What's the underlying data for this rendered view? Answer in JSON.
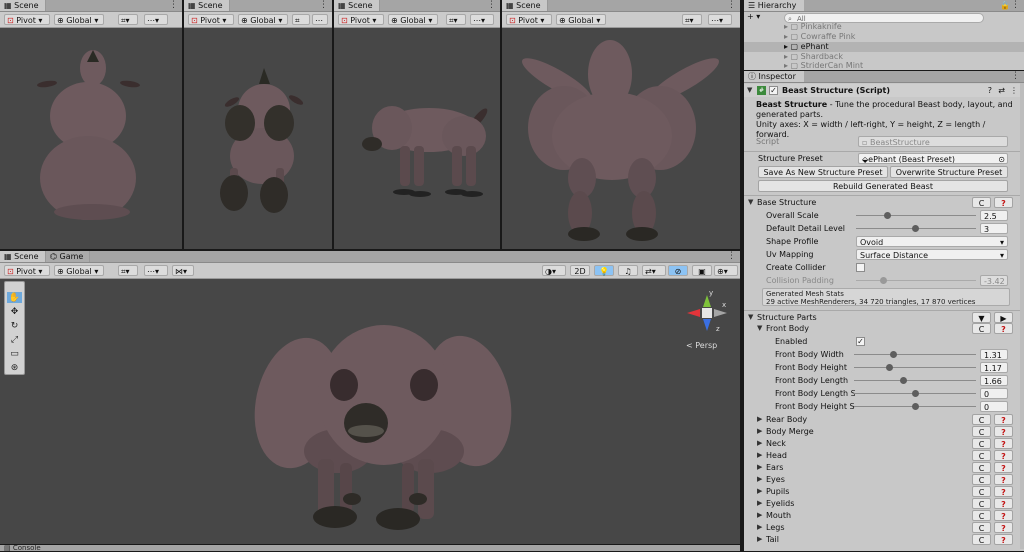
{
  "scene_panels": [
    {
      "tab": "Scene",
      "pivot": "Pivot",
      "global": "Global"
    },
    {
      "tab": "Scene",
      "pivot": "Pivot",
      "global": "Global"
    },
    {
      "tab": "Scene",
      "pivot": "Pivot",
      "global": "Global"
    },
    {
      "tab": "Scene",
      "pivot": "Pivot",
      "global": "Global"
    }
  ],
  "main_view": {
    "tabs": [
      "Scene",
      "Game"
    ],
    "pivot": "Pivot",
    "global": "Global",
    "mode_2d": "2D",
    "persp_label": "< Persp",
    "gizmo_axes": {
      "y": "y",
      "x": "x",
      "z": "z"
    }
  },
  "console_tab": "Console",
  "hierarchy": {
    "title": "Hierarchy",
    "add": "+ ▾",
    "search_placeholder": "All",
    "items": [
      "Pinkaknife",
      "Cowraffe Pink",
      "ePhant",
      "Shardback",
      "StriderCan Mint"
    ]
  },
  "inspector": {
    "title": "Inspector",
    "component_title": "Beast Structure (Script)",
    "desc_bold": "Beast Structure",
    "desc_rest": " - Tune the procedural Beast body, layout, and generated parts.",
    "desc_line2": "Unity axes: X = width / left-right, Y = height, Z = length / forward.",
    "script_label": "Script",
    "script_value": "BeastStructure",
    "preset_label": "Structure Preset",
    "preset_value": "ePhant (Beast Preset)",
    "save_preset": "Save As New Structure Preset",
    "overwrite_preset": "Overwrite Structure Preset",
    "rebuild": "Rebuild Generated Beast",
    "base_structure": "Base Structure",
    "overall_scale_label": "Overall Scale",
    "overall_scale": "2.5",
    "detail_label": "Default Detail Level",
    "detail": "3",
    "shape_label": "Shape Profile",
    "shape": "Ovoid",
    "uv_label": "Uv Mapping",
    "uv": "Surface Distance",
    "collider_label": "Create Collider",
    "padding_label": "Collision Padding",
    "padding": "-3.42",
    "stats_title": "Generated Mesh Stats",
    "stats_line": "29 active MeshRenderers, 34 720 triangles, 17 870 vertices",
    "structure_parts": "Structure Parts",
    "front_body": "Front Body",
    "enabled_label": "Enabled",
    "front_fields": [
      {
        "label": "Front Body Width",
        "value": "1.31"
      },
      {
        "label": "Front Body Height",
        "value": "1.17"
      },
      {
        "label": "Front Body Length",
        "value": "1.66"
      },
      {
        "label": "Front Body Length Sha",
        "value": "0"
      },
      {
        "label": "Front Body Height Sha",
        "value": "0"
      }
    ],
    "parts": [
      "Rear Body",
      "Body Merge",
      "Neck",
      "Head",
      "Ears",
      "Eyes",
      "Pupils",
      "Eyelids",
      "Mouth",
      "Legs",
      "Tail"
    ],
    "reset_glyph": "C",
    "help_glyph": "?"
  },
  "colors": {
    "beast": "#6e5a5e",
    "viewport": "#474747",
    "selected_row": "#b3b3b3"
  }
}
